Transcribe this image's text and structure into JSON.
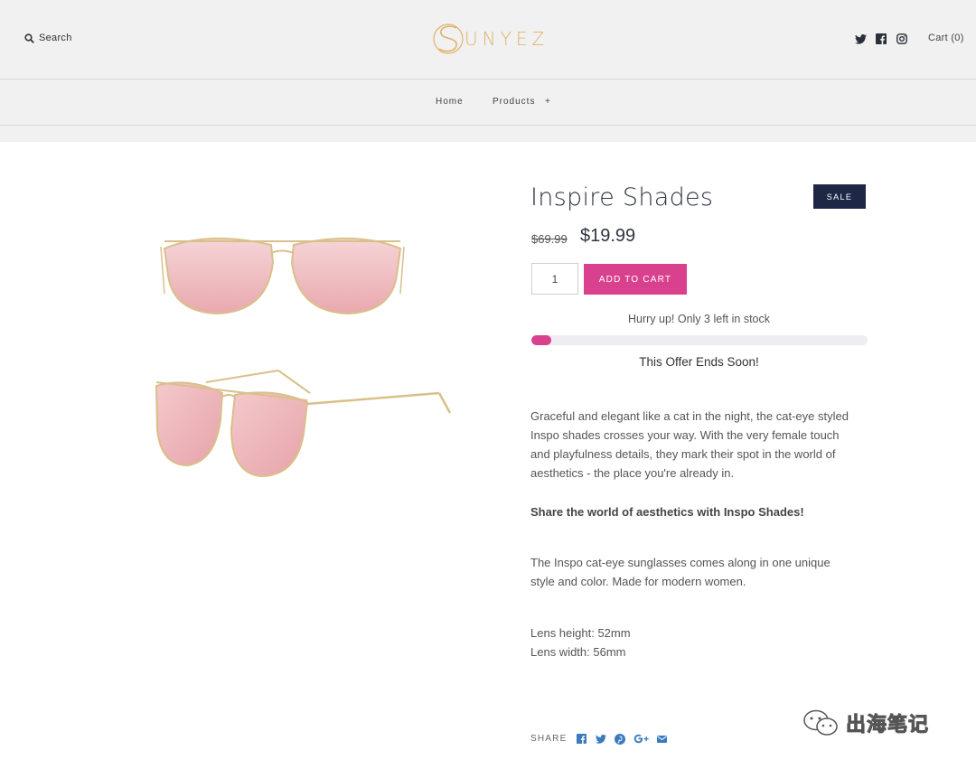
{
  "header": {
    "search_label": "Search",
    "brand": "UNYEZ",
    "cart_label": "Cart (0)"
  },
  "nav": {
    "home": "Home",
    "products": "Products",
    "products_expand": "+"
  },
  "product": {
    "title": "Inspire Shades",
    "badge": "SALE",
    "old_price": "$69.99",
    "price": "$19.99",
    "quantity": "1",
    "add_to_cart": "ADD TO CART",
    "stock_prefix": "Hurry up! Only",
    "stock_count": "3",
    "stock_suffix": "left in stock",
    "stock_level_percent": 6,
    "offer_text": "This Offer Ends Soon!",
    "description": {
      "p1": "Graceful and elegant like a cat in the night, the cat-eye styled Inspo shades crosses your way. With the very female touch and playfulness details, they mark their spot in the world of aesthetics - the place you're already in.",
      "p2": "Share the world of aesthetics with Inspo Shades!",
      "p3": "The Inspo cat-eye sunglasses comes along in one unique style and color. Made for modern women.",
      "spec1": "Lens height: 52mm",
      "spec2": "Lens width: 56mm"
    }
  },
  "share": {
    "label": "SHARE",
    "icons": [
      "facebook-icon",
      "twitter-icon",
      "pinterest-icon",
      "google-plus-icon",
      "email-icon"
    ]
  },
  "watermark": {
    "text": "出海笔记"
  },
  "colors": {
    "accent": "#d9418e",
    "badge": "#1f2747",
    "logo": "#e0b36a",
    "header_bg": "#f1f1f2"
  }
}
